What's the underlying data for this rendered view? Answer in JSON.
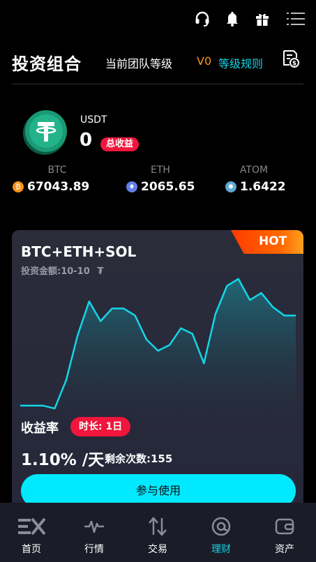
{
  "header": {
    "title": "投资组合",
    "team_level_label": "当前团队等级",
    "level": "V0",
    "rules_link": "等级规则"
  },
  "icons": {
    "support": "headset-icon",
    "notifications": "bell-icon",
    "gift": "gift-icon",
    "menu": "menu-icon",
    "records": "document-dollar-icon"
  },
  "balance": {
    "currency": "USDT",
    "value": "0",
    "badge": "总收益"
  },
  "coins": [
    {
      "name": "BTC",
      "price": "67043.89",
      "icon": "bitcoin-icon",
      "color": "#f7931a"
    },
    {
      "name": "ETH",
      "price": "2065.65",
      "icon": "ethereum-icon",
      "color": "#627eea"
    },
    {
      "name": "ATOM",
      "price": "1.6422",
      "icon": "cosmos-icon",
      "color": "#5fa8d3"
    }
  ],
  "product": {
    "hot_label": "HOT",
    "name": "BTC+ETH+SOL",
    "amount_label": "投资金额:10-10",
    "currency_symbol": "₮",
    "rate_label": "收益率",
    "duration_label": "时长: 1日",
    "daily_rate": "1.10% /天",
    "remaining_label": "剩余次数:155",
    "cta_label": "参与使用"
  },
  "chart_data": {
    "type": "area",
    "values": [
      10,
      10,
      10,
      8,
      28,
      60,
      84,
      70,
      79,
      79,
      74,
      57,
      49,
      53,
      65,
      61,
      40,
      75,
      95,
      100,
      85,
      90,
      80,
      74,
      74
    ],
    "title": "",
    "xlabel": "",
    "ylabel": ""
  },
  "nav": [
    {
      "label": "首页",
      "icon": "ex-logo-icon",
      "active": false
    },
    {
      "label": "行情",
      "icon": "pulse-icon",
      "active": false
    },
    {
      "label": "交易",
      "icon": "swap-arrows-icon",
      "active": false
    },
    {
      "label": "理财",
      "icon": "at-coin-icon",
      "active": true
    },
    {
      "label": "资产",
      "icon": "wallet-icon",
      "active": false
    }
  ],
  "colors": {
    "accent": "#13d6e8",
    "badge_red": "#f0163c",
    "level_orange": "#f7931a",
    "card_bg": "#2b2c3a"
  }
}
